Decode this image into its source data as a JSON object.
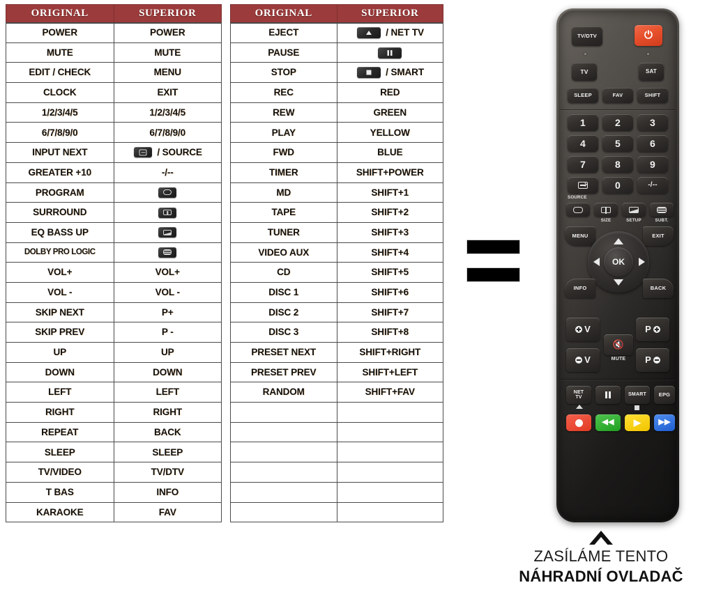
{
  "tables": [
    {
      "name": "table-left",
      "headers": [
        "ORIGINAL",
        "SUPERIOR"
      ],
      "rows": [
        {
          "original": "POWER",
          "superior": "POWER",
          "superior_icon": null
        },
        {
          "original": "MUTE",
          "superior": "MUTE",
          "superior_icon": null
        },
        {
          "original": "EDIT / CHECK",
          "superior": "MENU",
          "superior_icon": null
        },
        {
          "original": "CLOCK",
          "superior": "EXIT",
          "superior_icon": null
        },
        {
          "original": "1/2/3/4/5",
          "superior": "1/2/3/4/5",
          "superior_icon": null
        },
        {
          "original": "6/7/8/9/0",
          "superior": "6/7/8/9/0",
          "superior_icon": null
        },
        {
          "original": "INPUT NEXT",
          "superior": "/ SOURCE",
          "superior_icon": "source-key-icon"
        },
        {
          "original": "GREATER +10",
          "superior": "-/--",
          "superior_icon": null
        },
        {
          "original": "PROGRAM",
          "superior": "",
          "superior_icon": "screen-key-icon"
        },
        {
          "original": "SURROUND",
          "superior": "",
          "superior_icon": "size-key-icon"
        },
        {
          "original": "EQ BASS UP",
          "superior": "",
          "superior_icon": "setup-key-icon"
        },
        {
          "original": "DOLBY PRO LOGIC",
          "superior": "",
          "superior_icon": "subtitle-key-icon"
        },
        {
          "original": "VOL+",
          "superior": "VOL+",
          "superior_icon": null
        },
        {
          "original": "VOL -",
          "superior": "VOL -",
          "superior_icon": null
        },
        {
          "original": "SKIP NEXT",
          "superior": "P+",
          "superior_icon": null
        },
        {
          "original": "SKIP PREV",
          "superior": "P -",
          "superior_icon": null
        },
        {
          "original": "UP",
          "superior": "UP",
          "superior_icon": null
        },
        {
          "original": "DOWN",
          "superior": "DOWN",
          "superior_icon": null
        },
        {
          "original": "LEFT",
          "superior": "LEFT",
          "superior_icon": null
        },
        {
          "original": "RIGHT",
          "superior": "RIGHT",
          "superior_icon": null
        },
        {
          "original": "REPEAT",
          "superior": "BACK",
          "superior_icon": null
        },
        {
          "original": "SLEEP",
          "superior": "SLEEP",
          "superior_icon": null
        },
        {
          "original": "TV/VIDEO",
          "superior": "TV/DTV",
          "superior_icon": null
        },
        {
          "original": "T BAS",
          "superior": "INFO",
          "superior_icon": null
        },
        {
          "original": "KARAOKE",
          "superior": "FAV",
          "superior_icon": null
        }
      ]
    },
    {
      "name": "table-right",
      "headers": [
        "ORIGINAL",
        "SUPERIOR"
      ],
      "rows": [
        {
          "original": "EJECT",
          "superior": "/ NET TV",
          "superior_icon": "eject-key-icon"
        },
        {
          "original": "PAUSE",
          "superior": "",
          "superior_icon": "pause-key-icon"
        },
        {
          "original": "STOP",
          "superior": "/ SMART",
          "superior_icon": "stop-key-icon"
        },
        {
          "original": "REC",
          "superior": "RED",
          "superior_icon": null
        },
        {
          "original": "REW",
          "superior": "GREEN",
          "superior_icon": null
        },
        {
          "original": "PLAY",
          "superior": "YELLOW",
          "superior_icon": null
        },
        {
          "original": "FWD",
          "superior": "BLUE",
          "superior_icon": null
        },
        {
          "original": "TIMER",
          "superior": "SHIFT+POWER",
          "superior_icon": null
        },
        {
          "original": "MD",
          "superior": "SHIFT+1",
          "superior_icon": null
        },
        {
          "original": "TAPE",
          "superior": "SHIFT+2",
          "superior_icon": null
        },
        {
          "original": "TUNER",
          "superior": "SHIFT+3",
          "superior_icon": null
        },
        {
          "original": "VIDEO AUX",
          "superior": "SHIFT+4",
          "superior_icon": null
        },
        {
          "original": "CD",
          "superior": "SHIFT+5",
          "superior_icon": null
        },
        {
          "original": "DISC 1",
          "superior": "SHIFT+6",
          "superior_icon": null
        },
        {
          "original": "DISC 2",
          "superior": "SHIFT+7",
          "superior_icon": null
        },
        {
          "original": "DISC 3",
          "superior": "SHIFT+8",
          "superior_icon": null
        },
        {
          "original": "PRESET NEXT",
          "superior": "SHIFT+RIGHT",
          "superior_icon": null
        },
        {
          "original": "PRESET PREV",
          "superior": "SHIFT+LEFT",
          "superior_icon": null
        },
        {
          "original": "RANDOM",
          "superior": "SHIFT+FAV",
          "superior_icon": null
        },
        {
          "original": "",
          "superior": "",
          "superior_icon": null
        },
        {
          "original": "",
          "superior": "",
          "superior_icon": null
        },
        {
          "original": "",
          "superior": "",
          "superior_icon": null
        },
        {
          "original": "",
          "superior": "",
          "superior_icon": null
        },
        {
          "original": "",
          "superior": "",
          "superior_icon": null
        },
        {
          "original": "",
          "superior": "",
          "superior_icon": null
        }
      ]
    }
  ],
  "redactions": [
    {
      "name": "redaction-bar-top",
      "label": ""
    },
    {
      "name": "redaction-bar-bottom",
      "label": ""
    }
  ],
  "remote": {
    "buttons": {
      "tv_dtv": "TV/DTV",
      "power": "⏻",
      "tv": "TV",
      "sat": "SAT",
      "sleep": "SLEEP",
      "fav": "FAV",
      "shift": "SHIFT",
      "n1": "1",
      "n2": "2",
      "n3": "3",
      "n4": "4",
      "n5": "5",
      "n6": "6",
      "n7": "7",
      "n8": "8",
      "n9": "9",
      "source": "",
      "n0": "0",
      "dash": "-/--",
      "source_label": "SOURCE",
      "size_label": "SIZE",
      "setup_label": "SETUP",
      "subt_label": "SUBT.",
      "menu": "MENU",
      "exit": "EXIT",
      "ok": "OK",
      "info": "INFO",
      "back": "BACK",
      "vol_up": "V",
      "vol_down": "V",
      "mute": "MUTE",
      "p_up": "P",
      "p_down": "P",
      "net_tv": "NET\nTV",
      "pause": "",
      "smart": "SMART",
      "epg": "EPG",
      "rec": "",
      "rew": "",
      "play": "",
      "fwd": ""
    }
  },
  "footer": {
    "line1": "ZASÍLÁME TENTO",
    "line2": "NÁHRADNÍ OVLADAČ"
  },
  "colors": {
    "header_red": "#9C3B3B",
    "grid": "#4a4a4a",
    "power_red": "#e8502c",
    "media_red": "#e23b24",
    "media_green": "#20a020",
    "media_yellow": "#f2c400",
    "media_blue": "#1f5ed0",
    "background": "#ffffff"
  }
}
